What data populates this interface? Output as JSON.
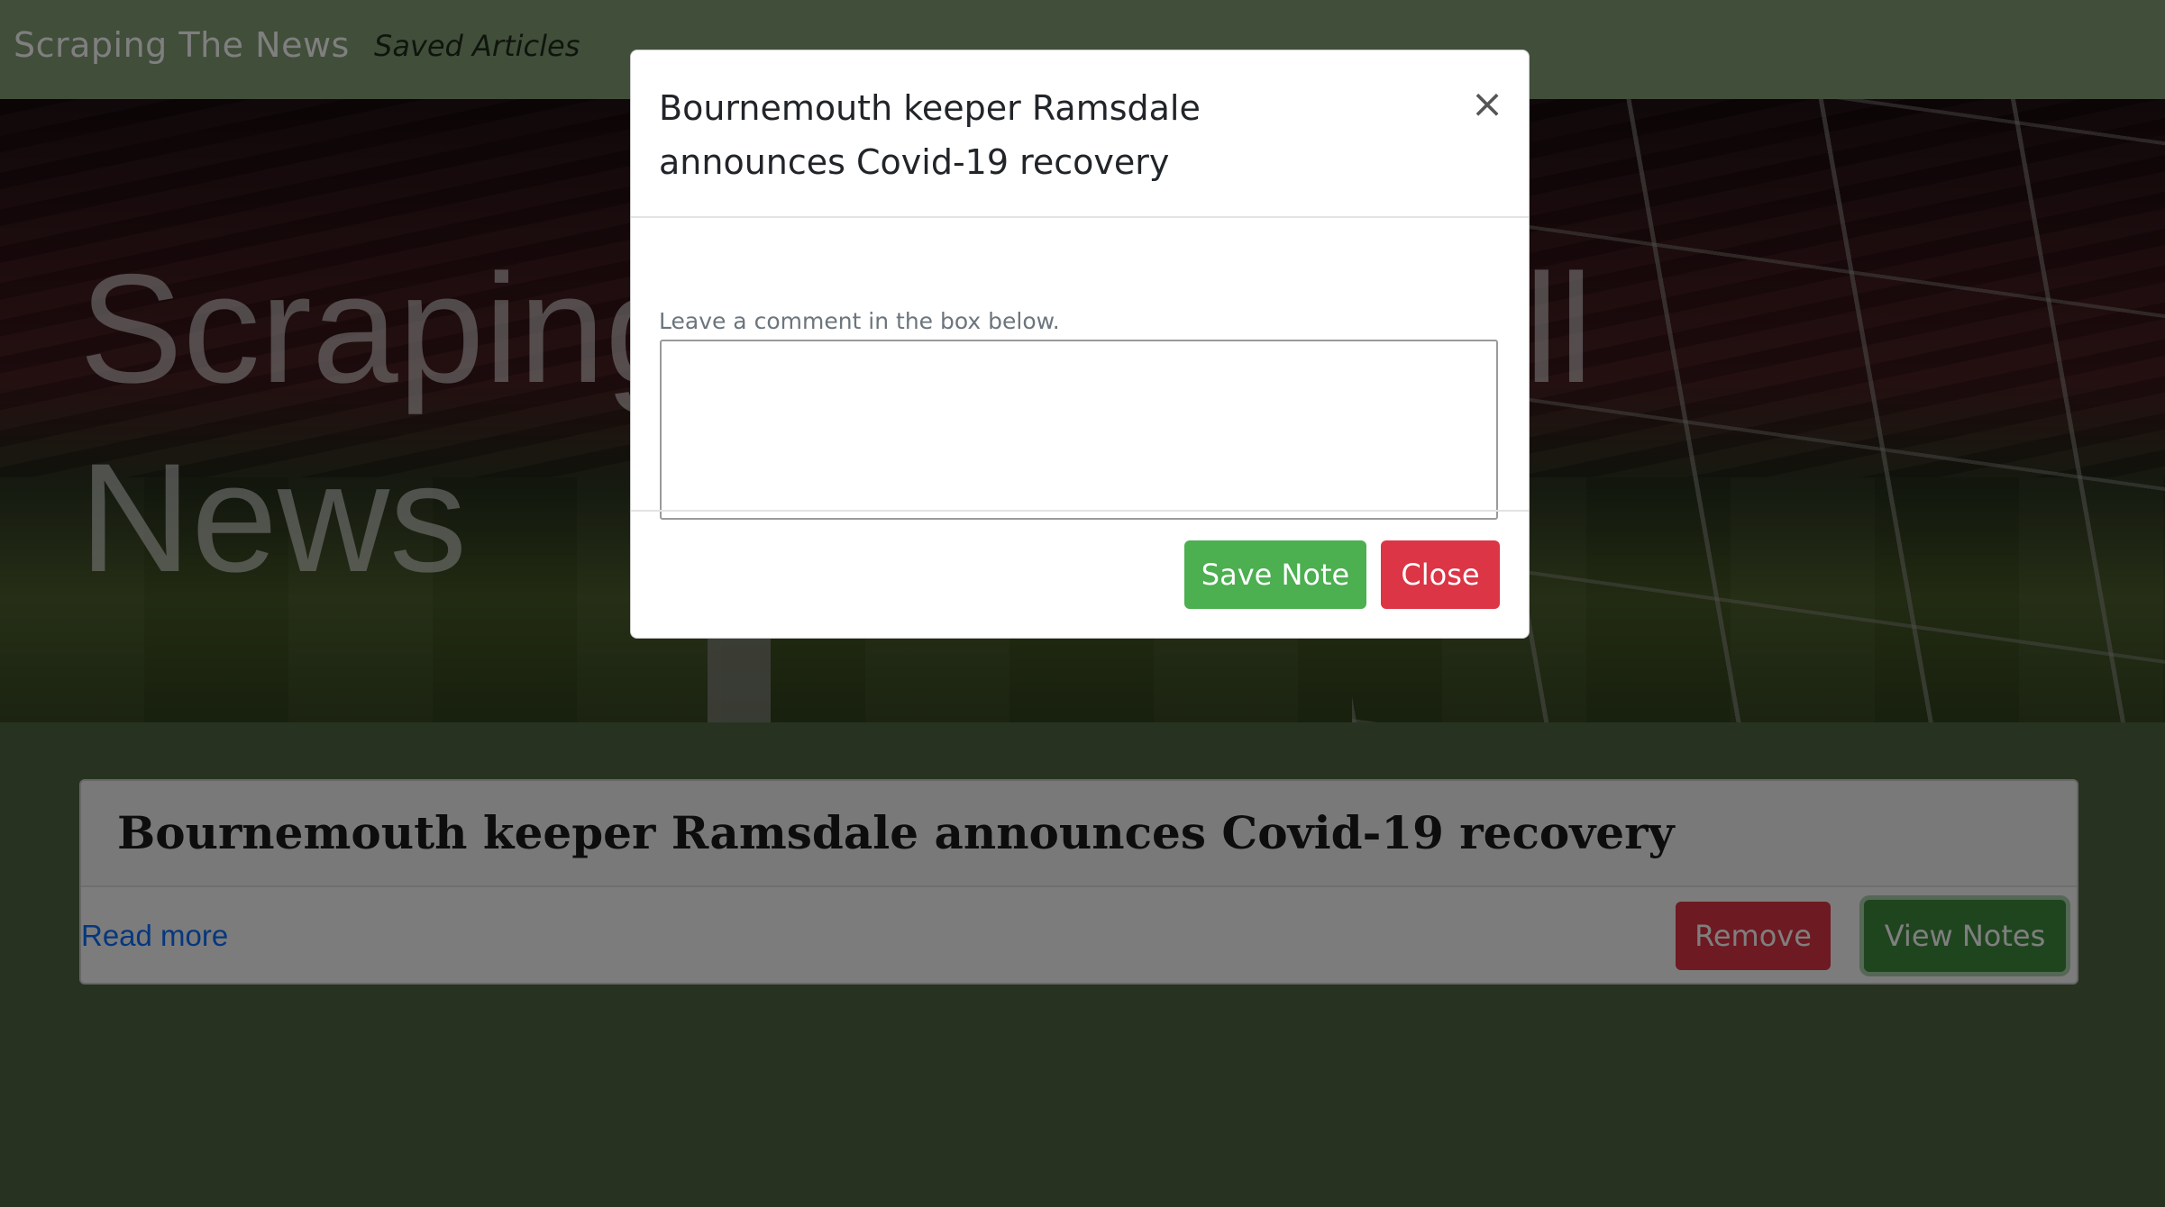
{
  "navbar": {
    "brand": "Scraping The News",
    "saved_link": "Saved Articles"
  },
  "hero": {
    "title": "Scraping The Football News"
  },
  "article": {
    "title": "Bournemouth keeper Ramsdale announces Covid-19 recovery",
    "read_more": "Read more",
    "remove_label": "Remove",
    "view_notes_label": "View Notes"
  },
  "modal": {
    "title": "Bournemouth keeper Ramsdale announces Covid-19 recovery",
    "close_icon": "×",
    "comment_label": "Leave a comment in the box below.",
    "textarea_value": "",
    "save_label": "Save Note",
    "close_label": "Close"
  },
  "colors": {
    "page_bg": "#4e6641",
    "navbar_bg": "#839c74",
    "save_green": "#4caf50",
    "danger_red": "#dc3545",
    "notes_green": "#3f8a3f",
    "link_blue": "#0d6efd"
  }
}
